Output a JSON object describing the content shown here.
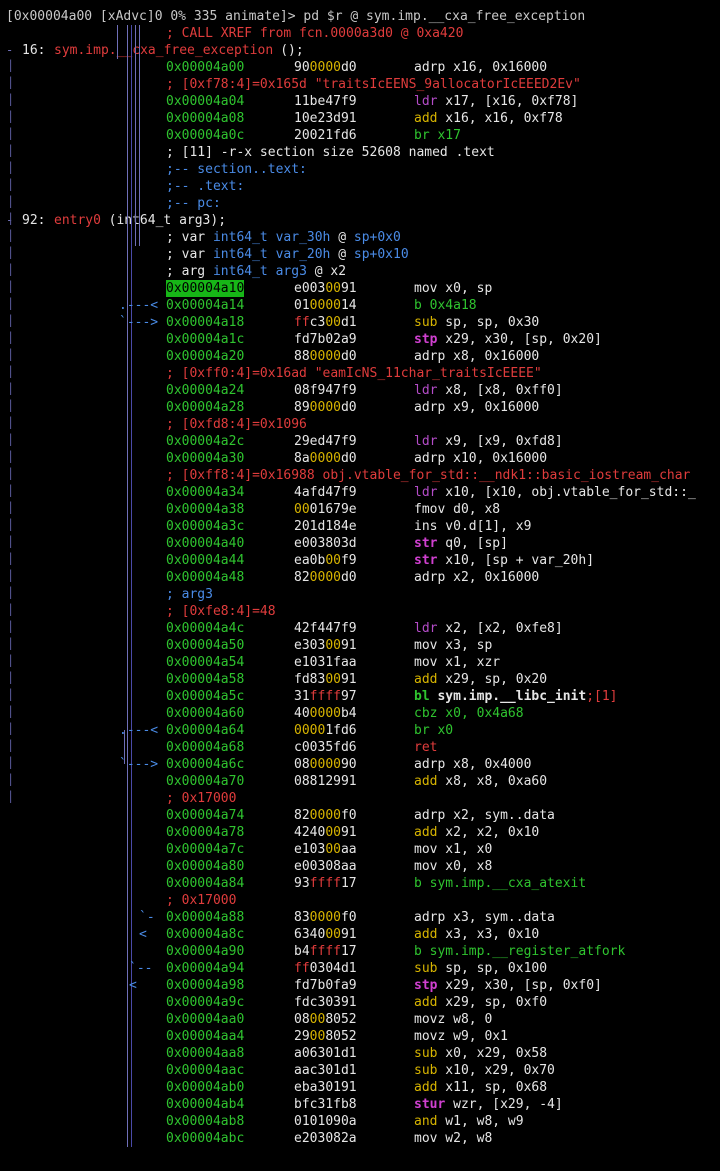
{
  "prompt": "[0x00004a00 [xAdvc]0 0% 335 animate]> pd $r @ sym.imp.__cxa_free_exception",
  "xref": "; CALL XREF from fcn.0000a3d0 @ 0xa420",
  "func1": {
    "num": "16:",
    "name": "sym.imp.__cxa_free_exception",
    "sig": " ();"
  },
  "func2": {
    "num": "92:",
    "name": "entry0",
    "sig": " (int64_t arg3);"
  },
  "rows": [
    {
      "a": "0x00004a00",
      "b": "900000d0",
      "m": "adrp",
      "o": " x16, 0x16000"
    },
    {
      "c": "; [0xf78:4]=0x165d \"traitsIcEENS_9allocatorIcEEED2Ev\""
    },
    {
      "a": "0x00004a04",
      "b": "11be47f9",
      "m": "ldr",
      "o": " x17, [x16, 0xf78]"
    },
    {
      "a": "0x00004a08",
      "b": "10e23d91",
      "m": "add",
      "o": " x16, x16, 0xf78"
    },
    {
      "a": "0x00004a0c",
      "b": "20021fd6",
      "m": "br",
      "o": " x17"
    },
    {
      "c": "; [11] -r-x section size 52608 named .text"
    },
    {
      "c": ";-- section..text:"
    },
    {
      "c": ";-- .text:"
    },
    {
      "c": ";-- pc:"
    },
    {
      "f": "2"
    },
    {
      "c": "; var int64_t var_30h @ sp+0x0"
    },
    {
      "c": "; var int64_t var_20h @ sp+0x10"
    },
    {
      "c": "; arg int64_t arg3 @ x2"
    },
    {
      "a": "0x00004a10",
      "b": "e0030091",
      "m": "mov",
      "o": " x0, sp"
    },
    {
      "a": "0x00004a14",
      "b": "01000014",
      "m": "b",
      "o": " 0x4a18"
    },
    {
      "a": "0x00004a18",
      "b": "ffc300d1",
      "m": "sub",
      "o": " sp, sp, 0x30"
    },
    {
      "a": "0x00004a1c",
      "b": "fd7b02a9",
      "m": "stp",
      "o": " x29, x30, [sp, 0x20]"
    },
    {
      "a": "0x00004a20",
      "b": "880000d0",
      "m": "adrp",
      "o": " x8, 0x16000"
    },
    {
      "c": "; [0xff0:4]=0x16ad \"eamIcNS_11char_traitsIcEEEE\""
    },
    {
      "a": "0x00004a24",
      "b": "08f947f9",
      "m": "ldr",
      "o": " x8, [x8, 0xff0]"
    },
    {
      "a": "0x00004a28",
      "b": "890000d0",
      "m": "adrp",
      "o": " x9, 0x16000"
    },
    {
      "c": "; [0xfd8:4]=0x1096"
    },
    {
      "a": "0x00004a2c",
      "b": "29ed47f9",
      "m": "ldr",
      "o": " x9, [x9, 0xfd8]"
    },
    {
      "a": "0x00004a30",
      "b": "8a0000d0",
      "m": "adrp",
      "o": " x10, 0x16000"
    },
    {
      "c": "; [0xff8:4]=0x16988 obj.vtable_for_std::__ndk1::basic_iostream_char"
    },
    {
      "a": "0x00004a34",
      "b": "4afd47f9",
      "m": "ldr",
      "o": " x10, [x10, obj.vtable_for_std::_"
    },
    {
      "a": "0x00004a38",
      "b": "0001679e",
      "m": "fmov",
      "o": " d0, x8"
    },
    {
      "a": "0x00004a3c",
      "b": "201d184e",
      "m": "ins",
      "o": " v0.d[1], x9"
    },
    {
      "a": "0x00004a40",
      "b": "e003803d",
      "m": "str",
      "o": " q0, [sp]"
    },
    {
      "a": "0x00004a44",
      "b": "ea0b00f9",
      "m": "str",
      "o": " x10, [sp + var_20h]"
    },
    {
      "a": "0x00004a48",
      "b": "820000d0",
      "m": "adrp",
      "o": " x2, 0x16000"
    },
    {
      "c": "; arg3"
    },
    {
      "c": "; [0xfe8:4]=48"
    },
    {
      "a": "0x00004a4c",
      "b": "42f447f9",
      "m": "ldr",
      "o": " x2, [x2, 0xfe8]"
    },
    {
      "a": "0x00004a50",
      "b": "e3030091",
      "m": "mov",
      "o": " x3, sp"
    },
    {
      "a": "0x00004a54",
      "b": "e1031faa",
      "m": "mov",
      "o": " x1, xzr"
    },
    {
      "a": "0x00004a58",
      "b": "fd830091",
      "m": "add",
      "o": " x29, sp, 0x20"
    },
    {
      "a": "0x00004a5c",
      "b": "31ffff97",
      "m": "bl",
      "o": " sym.imp.__libc_init",
      "x": ";[1]"
    },
    {
      "a": "0x00004a60",
      "b": "400000b4",
      "m": "cbz",
      "o": " x0, 0x4a68"
    },
    {
      "a": "0x00004a64",
      "b": "00001fd6",
      "m": "br",
      "o": " x0"
    },
    {
      "a": "0x00004a68",
      "b": "c0035fd6",
      "m": "ret",
      "o": ""
    },
    {
      "a": "0x00004a6c",
      "b": "08000090",
      "m": "adrp",
      "o": " x8, 0x4000"
    },
    {
      "a": "0x00004a70",
      "b": "08812991",
      "m": "add",
      "o": " x8, x8, 0xa60"
    },
    {
      "c": "; 0x17000"
    },
    {
      "a": "0x00004a74",
      "b": "820000f0",
      "m": "adrp",
      "o": " x2, sym..data"
    },
    {
      "a": "0x00004a78",
      "b": "42400091",
      "m": "add",
      "o": " x2, x2, 0x10"
    },
    {
      "a": "0x00004a7c",
      "b": "e10300aa",
      "m": "mov",
      "o": " x1, x0"
    },
    {
      "a": "0x00004a80",
      "b": "e00308aa",
      "m": "mov",
      "o": " x0, x8"
    },
    {
      "a": "0x00004a84",
      "b": "93ffff17",
      "m": "b",
      "o": " sym.imp.__cxa_atexit"
    },
    {
      "c": "; 0x17000"
    },
    {
      "a": "0x00004a88",
      "b": "830000f0",
      "m": "adrp",
      "o": " x3, sym..data"
    },
    {
      "a": "0x00004a8c",
      "b": "63400091",
      "m": "add",
      "o": " x3, x3, 0x10"
    },
    {
      "a": "0x00004a90",
      "b": "b4ffff17",
      "m": "b",
      "o": " sym.imp.__register_atfork"
    },
    {
      "a": "0x00004a94",
      "b": "ff0304d1",
      "m": "sub",
      "o": " sp, sp, 0x100"
    },
    {
      "a": "0x00004a98",
      "b": "fd7b0fa9",
      "m": "stp",
      "o": " x29, x30, [sp, 0xf0]"
    },
    {
      "a": "0x00004a9c",
      "b": "fdc30391",
      "m": "add",
      "o": " x29, sp, 0xf0"
    },
    {
      "a": "0x00004aa0",
      "b": "08008052",
      "m": "movz",
      "o": " w8, 0"
    },
    {
      "a": "0x00004aa4",
      "b": "29008052",
      "m": "movz",
      "o": " w9, 0x1"
    },
    {
      "a": "0x00004aa8",
      "b": "a06301d1",
      "m": "sub",
      "o": " x0, x29, 0x58"
    },
    {
      "a": "0x00004aac",
      "b": "aac301d1",
      "m": "sub",
      "o": " x10, x29, 0x70"
    },
    {
      "a": "0x00004ab0",
      "b": "eba30191",
      "m": "add",
      "o": " x11, sp, 0x68"
    },
    {
      "a": "0x00004ab4",
      "b": "bfc31fb8",
      "m": "stur",
      "o": " wzr, [x29, -4]"
    },
    {
      "a": "0x00004ab8",
      "b": "0101090a",
      "m": "and",
      "o": " w1, w8, w9"
    },
    {
      "a": "0x00004abc",
      "b": "e203082a",
      "m": "mov",
      "o": " w2, w8"
    }
  ],
  "arrows": {
    "back": "<",
    "fwd": ">"
  }
}
